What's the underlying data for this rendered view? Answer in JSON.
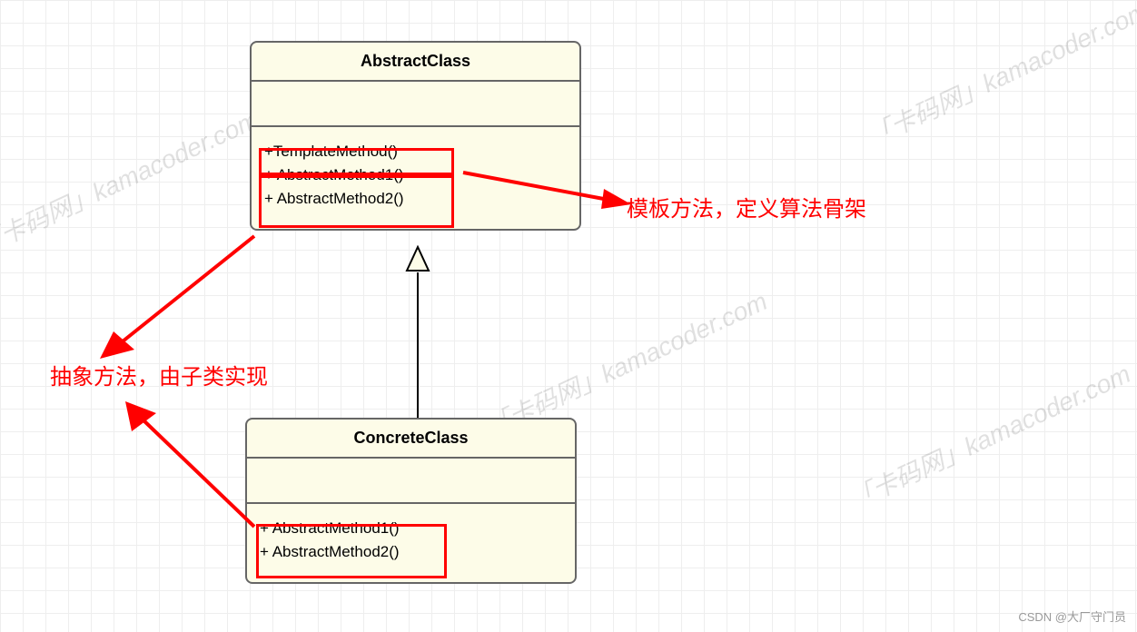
{
  "abstract_class": {
    "title": "AbstractClass",
    "methods": {
      "m1": "+TemplateMethod()",
      "m2": "+ AbstractMethod1()",
      "m3": "+ AbstractMethod2()"
    }
  },
  "concrete_class": {
    "title": "ConcreteClass",
    "methods": {
      "m1": "+ AbstractMethod1()",
      "m2": "+ AbstractMethod2()"
    }
  },
  "annotations": {
    "template_method": "模板方法，定义算法骨架",
    "abstract_method": "抽象方法，由子类实现"
  },
  "watermark": "「卡码网」kamacoder.com",
  "footer": "CSDN @大厂守门员"
}
